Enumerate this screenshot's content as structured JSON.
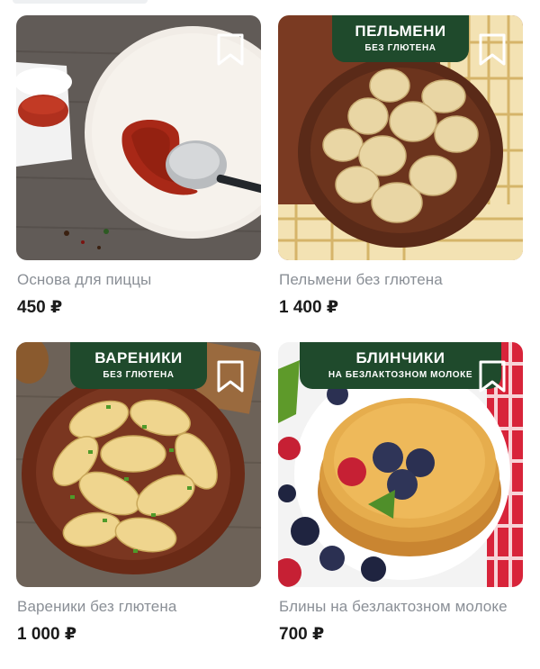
{
  "products": [
    {
      "name": "Основа для пиццы",
      "price": "450 ₽",
      "image_icon": "pizza-base-photo",
      "badge": null
    },
    {
      "name": "Пельмени без глютена",
      "price": "1 400 ₽",
      "image_icon": "pelmeni-photo",
      "badge": {
        "title": "ПЕЛЬМЕНИ",
        "subtitle": "БЕЗ ГЛЮТЕНА"
      }
    },
    {
      "name": "Вареники без глютена",
      "price": "1 000 ₽",
      "image_icon": "vareniki-photo",
      "badge": {
        "title": "ВАРЕНИКИ",
        "subtitle": "БЕЗ ГЛЮТЕНА"
      }
    },
    {
      "name": "Блины на безлактозном молоке",
      "price": "700 ₽",
      "image_icon": "pancakes-photo",
      "badge": {
        "title": "БЛИНЧИКИ",
        "subtitle": "НА БЕЗЛАКТОЗНОМ МОЛОКЕ"
      }
    }
  ],
  "colors": {
    "badge_bg": "#1f4a2c",
    "name_text": "#8a8f96",
    "price_text": "#1b1b1b"
  }
}
